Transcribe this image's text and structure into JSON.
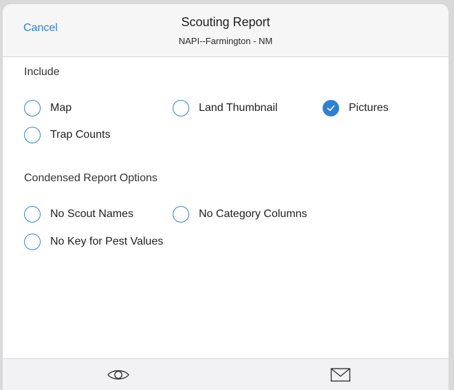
{
  "header": {
    "cancel_label": "Cancel",
    "title": "Scouting Report",
    "subtitle": "NAPI--Farmington - NM"
  },
  "include": {
    "label": "Include",
    "options": [
      {
        "label": "Map",
        "checked": false
      },
      {
        "label": "Land Thumbnail",
        "checked": false
      },
      {
        "label": "Pictures",
        "checked": true
      },
      {
        "label": "Trap Counts",
        "checked": false
      }
    ]
  },
  "condensed": {
    "label": "Condensed Report Options",
    "options": [
      {
        "label": "No Scout Names",
        "checked": false
      },
      {
        "label": "No Category Columns",
        "checked": false
      },
      {
        "label": "No Key for Pest Values",
        "checked": false
      }
    ]
  },
  "toolbar": {
    "icons": [
      "eye-icon",
      "mail-icon"
    ]
  },
  "colors": {
    "accent": "#2f7fd3",
    "header_bg": "#f6f6f7",
    "toolbar_bg": "#f2f2f4"
  }
}
